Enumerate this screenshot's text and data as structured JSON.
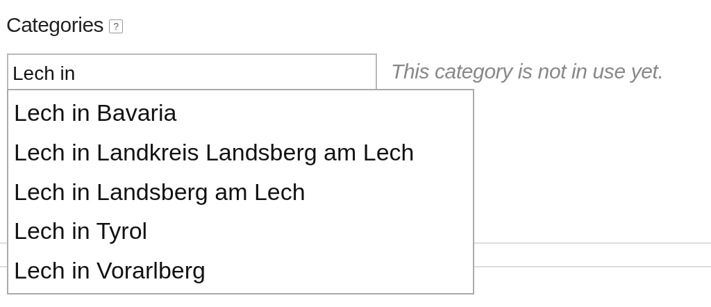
{
  "label": "Categories",
  "help_icon": "?",
  "field": {
    "value": "Lech in"
  },
  "hint": "This category is not in use yet.",
  "suggestions": [
    {
      "label": "Lech in Bavaria"
    },
    {
      "label": "Lech in Landkreis Landsberg am Lech"
    },
    {
      "label": "Lech in Landsberg am Lech"
    },
    {
      "label": "Lech in Tyrol"
    },
    {
      "label": "Lech in Vorarlberg"
    }
  ]
}
